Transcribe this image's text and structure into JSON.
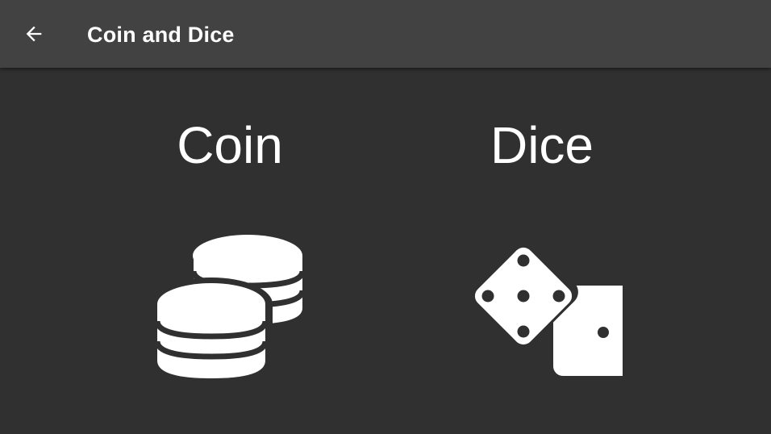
{
  "appbar": {
    "title": "Coin and Dice",
    "back_icon": "arrow-left-icon"
  },
  "options": [
    {
      "label": "Coin",
      "icon": "coins-icon"
    },
    {
      "label": "Dice",
      "icon": "dice-icon"
    }
  ],
  "colors": {
    "background": "#303030",
    "appbar": "#424242",
    "foreground": "#ffffff"
  }
}
